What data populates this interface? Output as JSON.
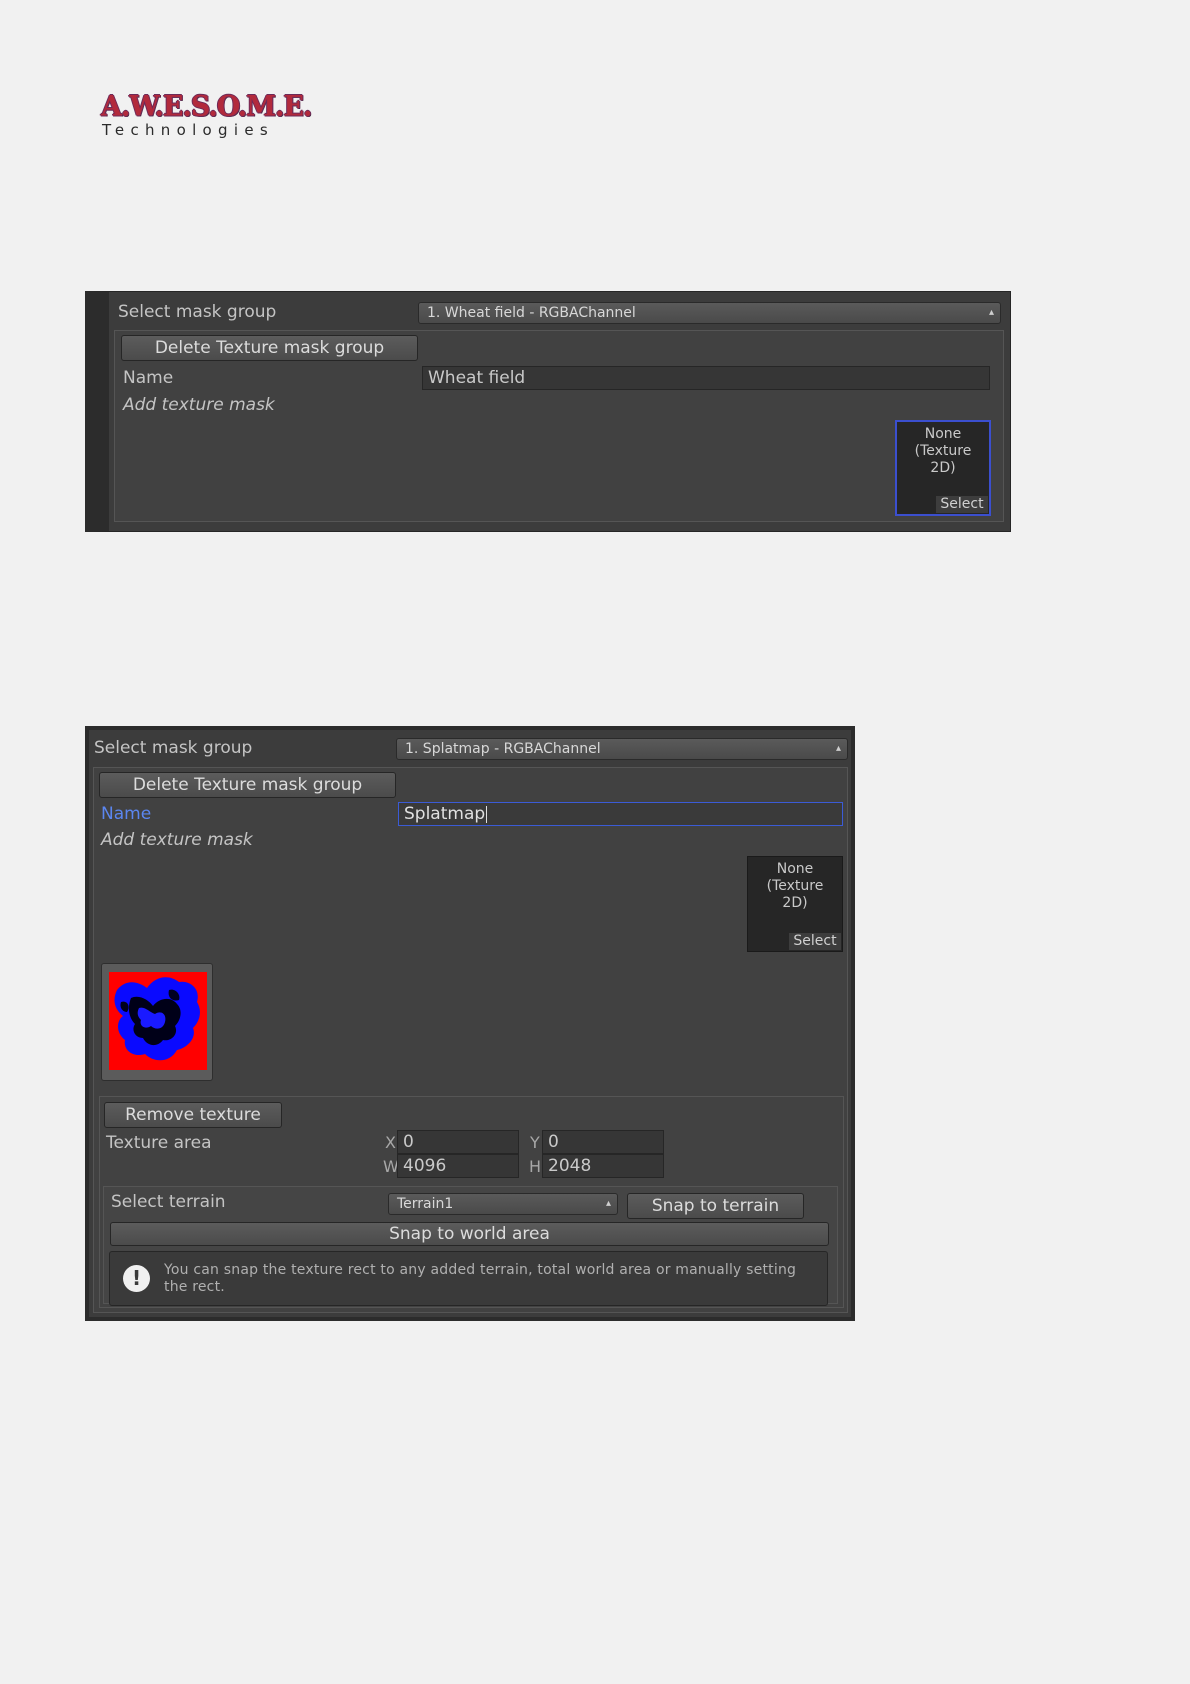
{
  "logo": {
    "main": "A.W.E.S.O.M.E.",
    "sub": "Technologies"
  },
  "panel1": {
    "select_mask_group_label": "Select mask group",
    "mask_group_value": "1. Wheat field - RGBAChannel",
    "delete_button": "Delete Texture mask group",
    "name_label": "Name",
    "name_value": "Wheat field",
    "add_texture_mask_label": "Add texture mask",
    "slot": {
      "line1": "None",
      "line2": "(Texture",
      "line3": "2D)",
      "select": "Select"
    }
  },
  "panel2": {
    "select_mask_group_label": "Select mask group",
    "mask_group_value": "1. Splatmap - RGBAChannel",
    "delete_button": "Delete Texture mask group",
    "name_label": "Name",
    "name_value": "Splatmap",
    "add_texture_mask_label": "Add texture mask",
    "slot": {
      "line1": "None",
      "line2": "(Texture",
      "line3": "2D)",
      "select": "Select"
    },
    "texture_preview_icon": "splatmap-texture",
    "remove_texture_button": "Remove texture",
    "texture_area_label": "Texture area",
    "x_label": "X",
    "x_value": "0",
    "y_label": "Y",
    "y_value": "0",
    "w_label": "W",
    "w_value": "4096",
    "h_label": "H",
    "h_value": "2048",
    "select_terrain_label": "Select terrain",
    "terrain_value": "Terrain1",
    "snap_to_terrain_button": "Snap to terrain",
    "snap_to_world_button": "Snap to world area",
    "help_icon": "exclamation-icon",
    "help_text": "You can snap the texture rect to any added terrain, total world area or manually setting the rect."
  },
  "colors": {
    "panel_bg": "#3c3c3c",
    "focus_accent": "#3b5bd6",
    "page_bg": "#f1f1f1"
  }
}
